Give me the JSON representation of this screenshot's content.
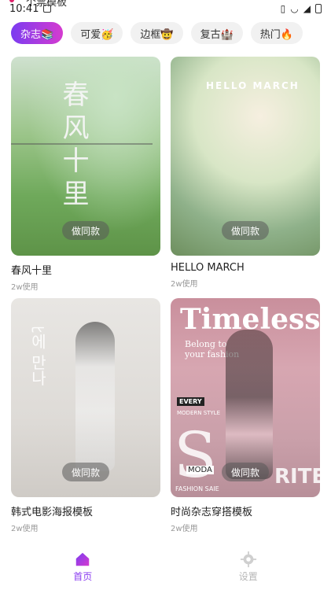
{
  "status_bar": {
    "time": "10:41",
    "cutoff_title": "个票模板"
  },
  "chips": [
    {
      "label": "杂志📚",
      "active": true
    },
    {
      "label": "可爱🥳",
      "active": false
    },
    {
      "label": "边框🤠",
      "active": false
    },
    {
      "label": "复古🏰",
      "active": false
    },
    {
      "label": "热门🔥",
      "active": false
    }
  ],
  "cards": [
    {
      "title": "春风十里",
      "uses": "2w使用",
      "button": "做同款",
      "overlay_text": "春风十里",
      "bg_class": "ph-green"
    },
    {
      "title": "HELLO MARCH",
      "uses": "2w使用",
      "button": "做同款",
      "overlay_text": "HELLO MARCH",
      "bg_class": "ph-sunny"
    },
    {
      "title": "韩式电影海报模板",
      "uses": "2w使用",
      "button": "做同款",
      "overlay_text": "ﾋ에 만나",
      "bg_class": "ph-studio"
    },
    {
      "title": "时尚杂志穿搭模板",
      "uses": "2w使用",
      "button": "做同款",
      "overlay_text": "Timeless",
      "overlay_text2": "Belong to your fashion",
      "overlay_text3": "EVERY",
      "overlay_text4": "MODERN STYLE",
      "overlay_text5": "FASHION SAIE",
      "overlay_text6": "S",
      "overlay_text7": "RITE",
      "overlay_text8": "MODA",
      "bg_class": "ph-pink"
    }
  ],
  "bottom_nav": [
    {
      "label": "首页",
      "icon": "home-icon",
      "active": true
    },
    {
      "label": "设置",
      "icon": "gear-icon",
      "active": false
    }
  ],
  "colors": {
    "accent_start": "#7b3cf0",
    "accent_end": "#d53bd0",
    "active_nav": "#8a3cf0"
  }
}
